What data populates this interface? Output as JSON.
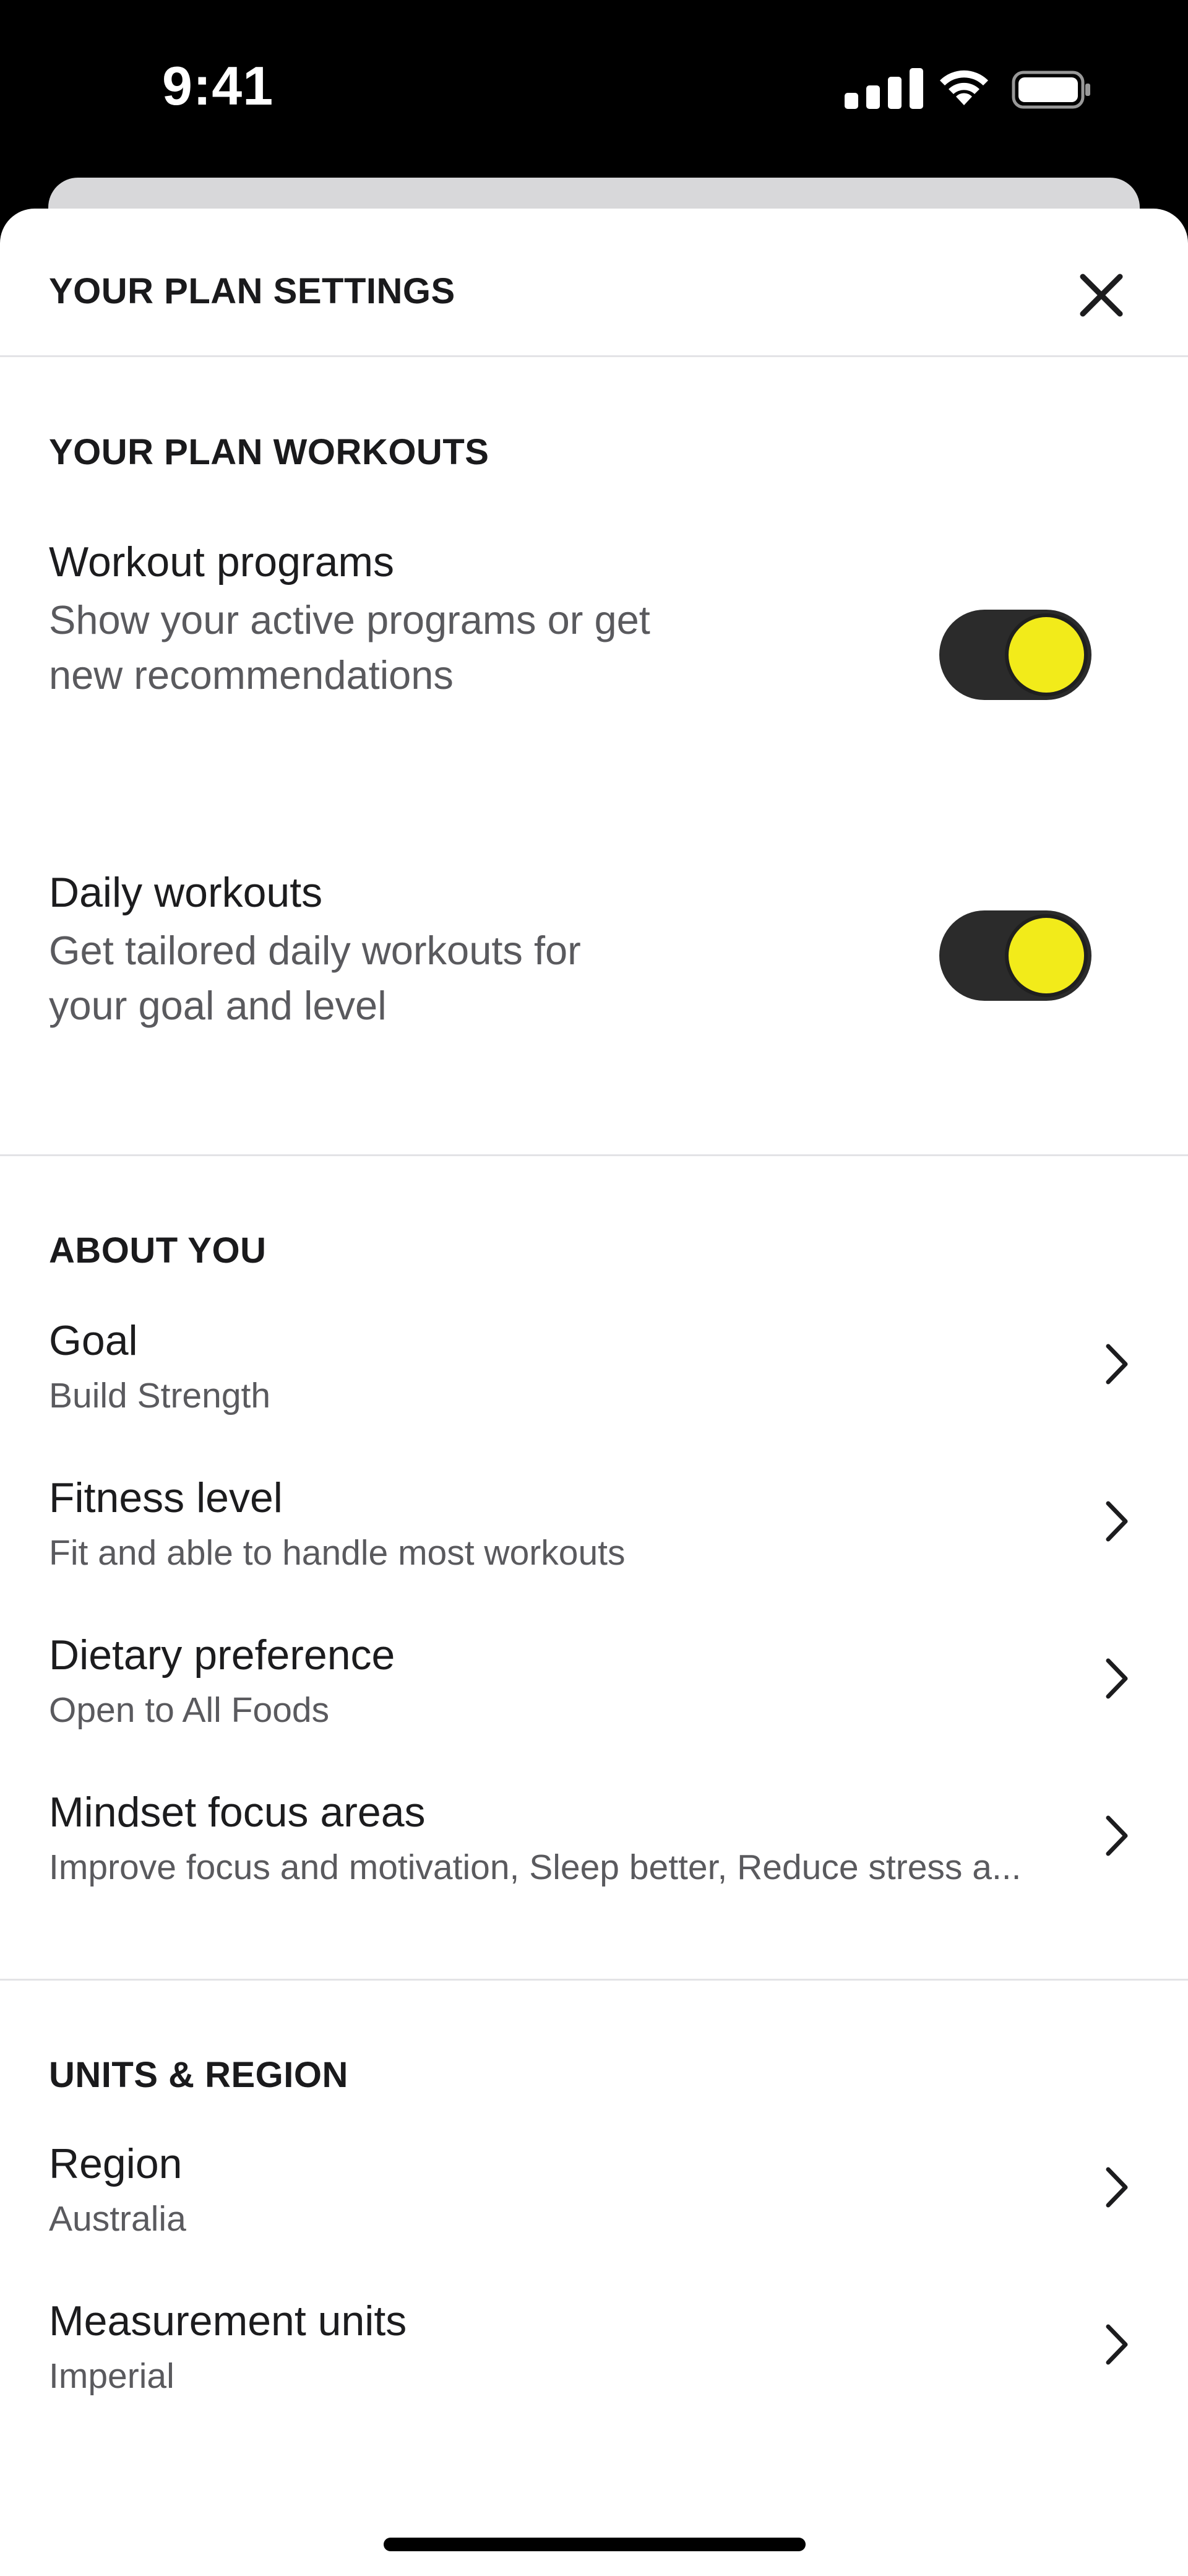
{
  "status_bar": {
    "time": "9:41",
    "icons": [
      "signal-icon",
      "wifi-icon",
      "battery-icon"
    ]
  },
  "header": {
    "title": "YOUR PLAN SETTINGS",
    "close_icon": "close-icon"
  },
  "sections": {
    "workouts": {
      "heading": "YOUR PLAN WORKOUTS",
      "items": [
        {
          "title": "Workout programs",
          "description": "Show your active programs or get new recommendations",
          "enabled": true
        },
        {
          "title": "Daily workouts",
          "description": "Get tailored daily workouts for your goal and level",
          "enabled": true
        }
      ]
    },
    "about": {
      "heading": "ABOUT YOU",
      "items": [
        {
          "title": "Goal",
          "value": "Build Strength"
        },
        {
          "title": "Fitness level",
          "value": "Fit and able to handle most workouts"
        },
        {
          "title": "Dietary preference",
          "value": "Open to All Foods"
        },
        {
          "title": "Mindset focus areas",
          "value": "Improve focus and motivation, Sleep better, Reduce stress a..."
        }
      ]
    },
    "units": {
      "heading": "UNITS & REGION",
      "items": [
        {
          "title": "Region",
          "value": "Australia"
        },
        {
          "title": "Measurement units",
          "value": "Imperial"
        }
      ]
    }
  },
  "colors": {
    "toggle_track": "#2b2b2b",
    "toggle_knob": "#f2eb1a",
    "divider": "#e3e3e6",
    "secondary_text": "#5a5a5e"
  }
}
